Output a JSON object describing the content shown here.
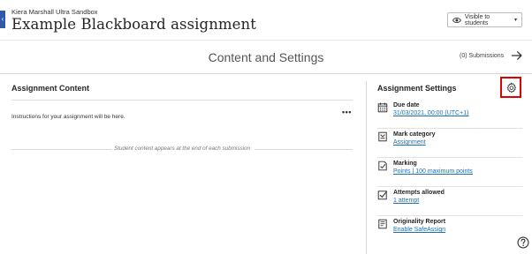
{
  "header": {
    "left_tab_glyph": "‹",
    "course_name": "Kiera Marshall Ultra Sandbox",
    "assignment_title": "Example Blackboard assignment",
    "visibility": {
      "label": "Visible to students",
      "icon": "eye-icon",
      "caret": "▾"
    }
  },
  "band": {
    "title": "Content and Settings",
    "submissions_label": "(0) Submissions",
    "arrow_icon": "arrow-right-icon"
  },
  "content": {
    "heading": "Assignment Content",
    "instructions": "Instructions for your assignment will be here.",
    "more_menu": "•••",
    "student_note": "Student content appears at the end of each submission"
  },
  "settings": {
    "heading": "Assignment Settings",
    "gear_icon": "gear-icon",
    "highlight_color": "#e00000",
    "link_color": "#1a70b8",
    "items": [
      {
        "label": "Due date",
        "value": "31/03/2021, 00:00 (UTC+1)",
        "icon": "calendar-icon"
      },
      {
        "label": "Mark category",
        "value": "Assignment",
        "icon": "category-icon"
      },
      {
        "label": "Marking",
        "value": "Points",
        "separator": "|",
        "value2": "100 maximum points",
        "icon": "marking-icon"
      },
      {
        "label": "Attempts allowed",
        "value": "1 attempt",
        "icon": "attempts-icon"
      },
      {
        "label": "Originality Report",
        "value": "Enable SafeAssign",
        "icon": "originality-icon"
      }
    ]
  },
  "help_icon": "help-icon"
}
